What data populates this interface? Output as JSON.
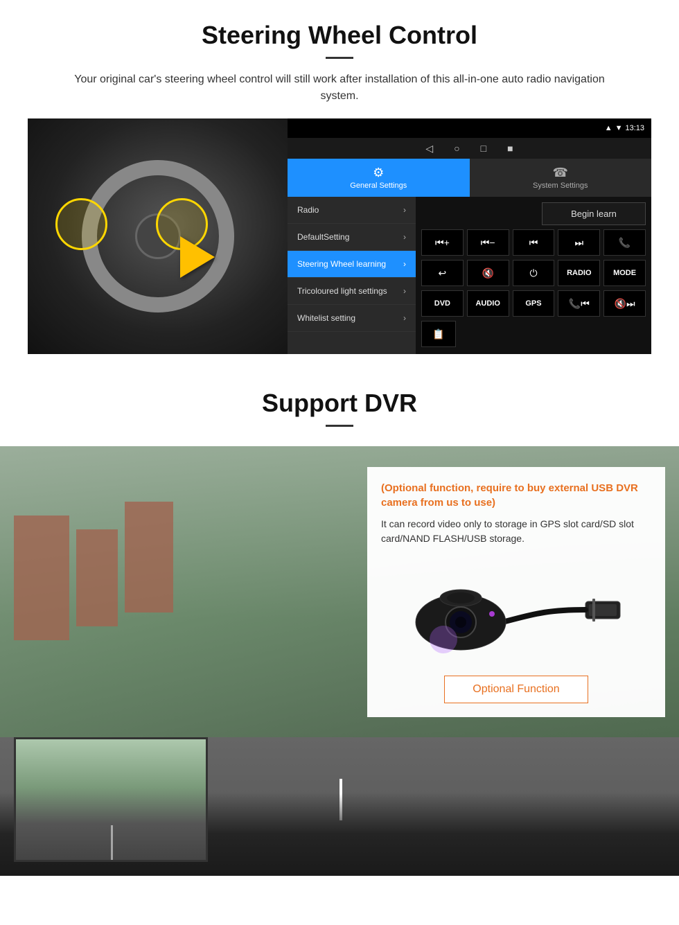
{
  "page": {
    "section1": {
      "title": "Steering Wheel Control",
      "subtitle": "Your original car's steering wheel control will still work after installation of this all-in-one auto radio navigation system.",
      "android_ui": {
        "statusbar": {
          "time": "13:13",
          "icons": [
            "signal",
            "wifi",
            "battery"
          ]
        },
        "navbar": {
          "buttons": [
            "◁",
            "○",
            "□",
            "■"
          ]
        },
        "tabs": [
          {
            "label": "General Settings",
            "icon": "⚙",
            "active": true
          },
          {
            "label": "System Settings",
            "icon": "☎",
            "active": false
          }
        ],
        "menu_items": [
          {
            "label": "Radio",
            "active": false
          },
          {
            "label": "DefaultSetting",
            "active": false
          },
          {
            "label": "Steering Wheel learning",
            "active": true
          },
          {
            "label": "Tricoloured light settings",
            "active": false
          },
          {
            "label": "Whitelist setting",
            "active": false
          }
        ],
        "begin_learn": "Begin learn",
        "control_rows": [
          [
            "⏮+",
            "⏮-",
            "⏮",
            "⏭",
            "📞"
          ],
          [
            "↩",
            "🔇",
            "⏻",
            "RADIO",
            "MODE"
          ],
          [
            "DVD",
            "AUDIO",
            "GPS",
            "📞⏮",
            "🔇⏭"
          ],
          [
            "📋"
          ]
        ]
      }
    },
    "section2": {
      "title": "Support DVR",
      "info_panel": {
        "orange_text": "(Optional function, require to buy external USB DVR camera from us to use)",
        "body_text": "It can record video only to storage in GPS slot card/SD slot card/NAND FLASH/USB storage.",
        "optional_function_label": "Optional Function"
      }
    }
  }
}
